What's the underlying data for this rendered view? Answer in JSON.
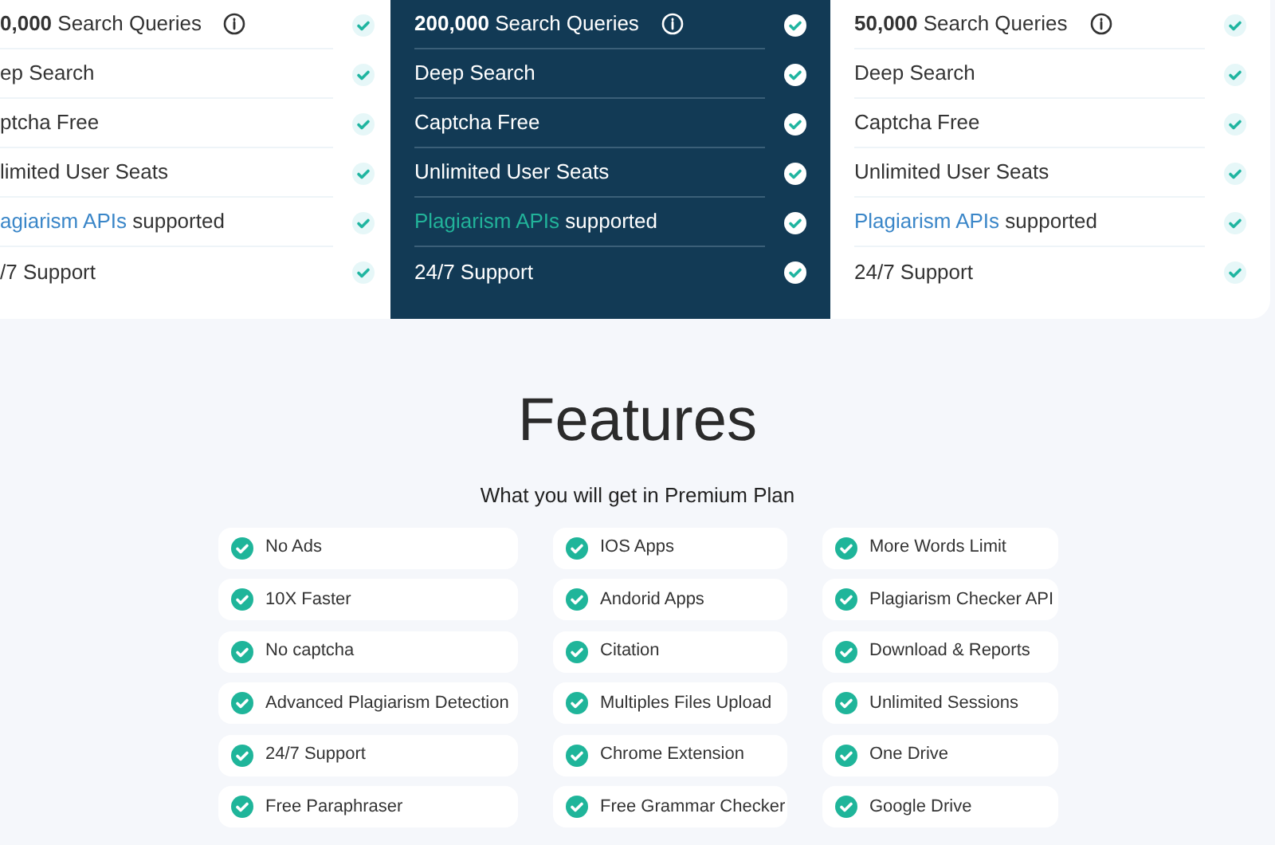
{
  "pricing_cards": [
    {
      "highlighted": false,
      "features": [
        {
          "kind": "queries",
          "text": "**0,000** Search Queries"
        },
        {
          "kind": "plain",
          "text": "ep Search"
        },
        {
          "kind": "plain",
          "text": "ptcha Free"
        },
        {
          "kind": "plain",
          "text": "limited User Seats"
        },
        {
          "kind": "link",
          "link": "agiarism APIs",
          "text": "supported"
        },
        {
          "kind": "plain",
          "text": "/7 Support"
        }
      ]
    },
    {
      "highlighted": true,
      "features": [
        {
          "kind": "queries",
          "text": "**200,000** Search Queries"
        },
        {
          "kind": "plain",
          "text": "Deep Search"
        },
        {
          "kind": "plain",
          "text": "Captcha Free"
        },
        {
          "kind": "plain",
          "text": "Unlimited User Seats"
        },
        {
          "kind": "link",
          "link": "Plagiarism APIs",
          "text": "supported"
        },
        {
          "kind": "plain",
          "text": "24/7 Support"
        }
      ]
    },
    {
      "highlighted": false,
      "features": [
        {
          "kind": "queries",
          "text": "**50,000** Search Queries"
        },
        {
          "kind": "plain",
          "text": "Deep Search"
        },
        {
          "kind": "plain",
          "text": "Captcha Free"
        },
        {
          "kind": "plain",
          "text": "Unlimited User Seats"
        },
        {
          "kind": "link",
          "link": "Plagiarism APIs",
          "text": "supported"
        },
        {
          "kind": "plain",
          "text": "24/7 Support"
        }
      ]
    }
  ],
  "features": {
    "title": "Features",
    "subtitle": "What you will get in Premium Plan",
    "columns": [
      [
        "No Ads",
        "10X Faster",
        "No captcha",
        "Advanced Plagiarism Detection",
        "24/7 Support",
        "Free Paraphraser"
      ],
      [
        "IOS Apps",
        "Andorid Apps",
        "Citation",
        "Multiples Files Upload",
        "Chrome Extension",
        "Free Grammar Checker"
      ],
      [
        "More Words Limit",
        "Plagiarism Checker API",
        "Download & Reports",
        "Unlimited Sessions",
        "One Drive",
        "Google Drive"
      ]
    ]
  }
}
